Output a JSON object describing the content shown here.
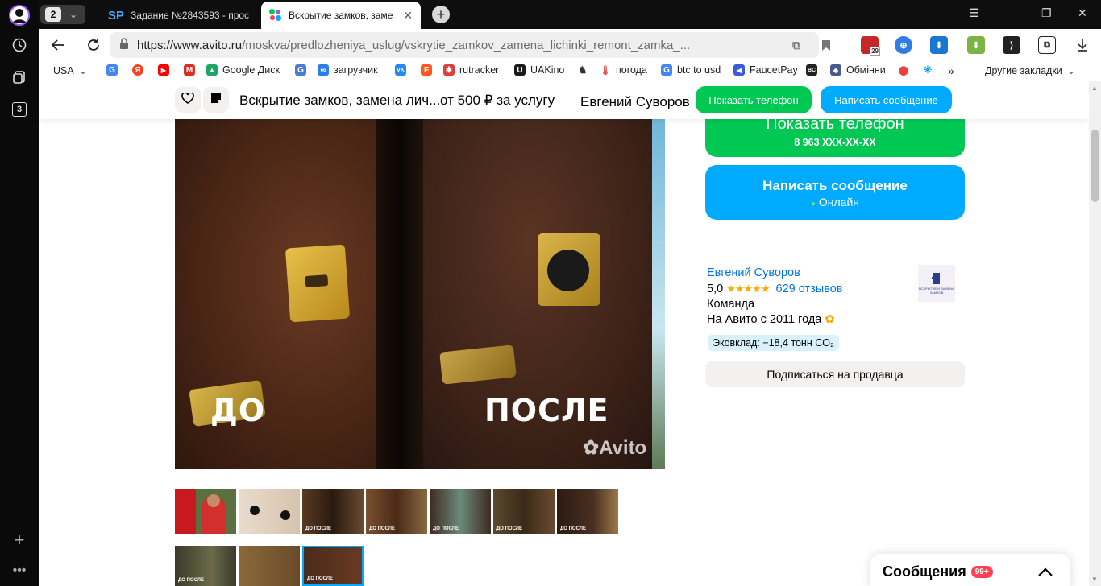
{
  "browser": {
    "tab_count": "2",
    "tabs": [
      {
        "favicon": "SP",
        "title": "Задание №2843593 - прос"
      },
      {
        "title": "Вскрытие замков, заме"
      }
    ],
    "sidebar_count": "3",
    "url_host": "https://www.avito.ru",
    "url_path": "/moskva/predlozheniya_uslug/vskrytie_zamkov_zamena_lichinki_remont_zamka_...",
    "ext_badge": "29",
    "bookmarks": [
      {
        "label": "USA",
        "icon": "dropdown",
        "color": "#555555"
      },
      {
        "label": "",
        "icon": "G",
        "color": "#4285f4"
      },
      {
        "label": "",
        "icon": "Я",
        "color": "#fc3f1d"
      },
      {
        "label": "",
        "icon": "▶",
        "color": "#ff0000"
      },
      {
        "label": "",
        "icon": "M",
        "color": "#d93025"
      },
      {
        "label": "Google Диск",
        "icon": "▲",
        "color": "#1fa463"
      },
      {
        "label": "",
        "icon": "G",
        "color": "#4a7bd6"
      },
      {
        "label": "загрузчик",
        "icon": "∞",
        "color": "#2b7de9"
      },
      {
        "label": "",
        "icon": "VK",
        "color": "#2787f5"
      },
      {
        "label": "",
        "icon": "F",
        "color": "#ff5722"
      },
      {
        "label": "rutracker",
        "icon": "✱",
        "color": "#d6403d"
      },
      {
        "label": "UAKino",
        "icon": "U",
        "color": "#1a1a1a"
      },
      {
        "label": "",
        "icon": "♞",
        "color": "#333333"
      },
      {
        "label": "погода",
        "icon": "🌡",
        "color": "#e53935"
      },
      {
        "label": "btc to usd",
        "icon": "G",
        "color": "#4285f4"
      },
      {
        "label": "FaucetPay",
        "icon": "◀",
        "color": "#3b5bdb"
      },
      {
        "label": "",
        "icon": "BC",
        "color": "#222222"
      },
      {
        "label": "Обмінни",
        "icon": "◆",
        "color": "#4a5a8a"
      },
      {
        "label": "",
        "icon": "⬤",
        "color": "#ea4335"
      },
      {
        "label": "",
        "icon": "✳",
        "color": "#1aa3e8"
      }
    ],
    "bookmarks_more": "»",
    "other_bookmarks": "Другие закладки"
  },
  "sticky": {
    "title": "Вскрытие замков, замена лич...",
    "price": "от 500 ₽ за услугу",
    "seller": "Евгений Суворов",
    "show_phone": "Показать телефон",
    "write_message": "Написать сообщение",
    "show_phone_color": "#00c853",
    "write_message_color": "#00aaff"
  },
  "gallery": {
    "before_label": "ДО",
    "after_label": "ПОСЛЕ",
    "watermark": "Avito",
    "thumbs": [
      {
        "label": "",
        "bg": "#c8191f"
      },
      {
        "label": "",
        "bg": "#e6d6c8"
      },
      {
        "label": "ДО ПОСЛЕ",
        "bg": "#4a2a1a"
      },
      {
        "label": "ДО ПОСЛЕ",
        "bg": "#5a3a22"
      },
      {
        "label": "ДО ПОСЛЕ",
        "bg": "#3f2b22"
      },
      {
        "label": "ДО ПОСЛЕ",
        "bg": "#6a4a30"
      },
      {
        "label": "ДО ПОСЛЕ",
        "bg": "#2c1a14"
      },
      {
        "label": "ДО ПОСЛЕ",
        "bg": "#3a3a2a"
      },
      {
        "label": "",
        "bg": "#7a5a3a"
      },
      {
        "label": "ДО ПОСЛЕ",
        "bg": "#4a2a1a"
      }
    ]
  },
  "contact": {
    "phone_title": "Показать телефон",
    "phone_number": "8 963 XXX-XX-XX",
    "message_title": "Написать сообщение",
    "online": "Онлайн"
  },
  "seller": {
    "name": "Евгений Суворов",
    "rating": "5,0",
    "stars": "★★★★★",
    "reviews": "629 отзывов",
    "type": "Команда",
    "since": "На Авито с 2011 года",
    "eco": "Эковклад: −18,4 тонн CO₂",
    "subscribe": "Подписаться на продавца",
    "logo_text": "ВСКРЫТИЕ И ЗАМЕНА ЗАМКОВ"
  },
  "messages": {
    "title": "Сообщения",
    "badge": "99+"
  }
}
